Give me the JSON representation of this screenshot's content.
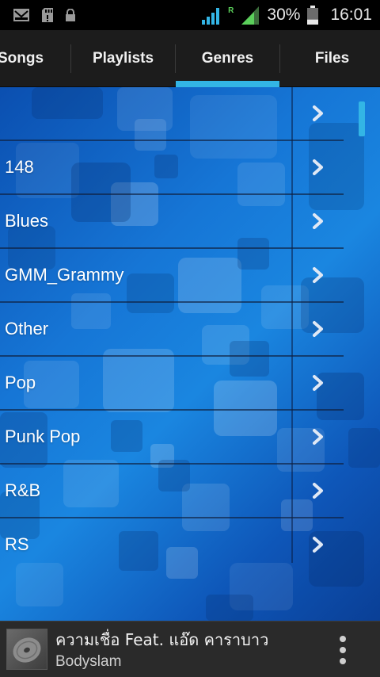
{
  "status_bar": {
    "icons": [
      "gmail-icon",
      "sd-card-icon",
      "lock-icon",
      "wifi-signal-icon",
      "roaming-r-icon",
      "cell-signal-icon",
      "battery-icon"
    ],
    "battery_percent": "30%",
    "battery_level": 0.3,
    "roaming_label": "R",
    "time": "16:01"
  },
  "tabs": [
    {
      "label": "Songs",
      "selected": false
    },
    {
      "label": "Playlists",
      "selected": false
    },
    {
      "label": "Genres",
      "selected": true
    },
    {
      "label": "Files",
      "selected": false
    }
  ],
  "genres": [
    {
      "label": ""
    },
    {
      "label": "148"
    },
    {
      "label": "Blues"
    },
    {
      "label": "GMM_Grammy"
    },
    {
      "label": "Other"
    },
    {
      "label": "Pop"
    },
    {
      "label": "Punk Pop"
    },
    {
      "label": "R&B"
    },
    {
      "label": "RS"
    }
  ],
  "now_playing": {
    "title": "ความเชื่อ Feat. แอ๊ด คาราบาว",
    "artist": "Bodyslam"
  },
  "colors": {
    "accent": "#33b5e5",
    "tab_bar": "#1c1c1c",
    "now_playing_bar": "#2a2a2a"
  }
}
